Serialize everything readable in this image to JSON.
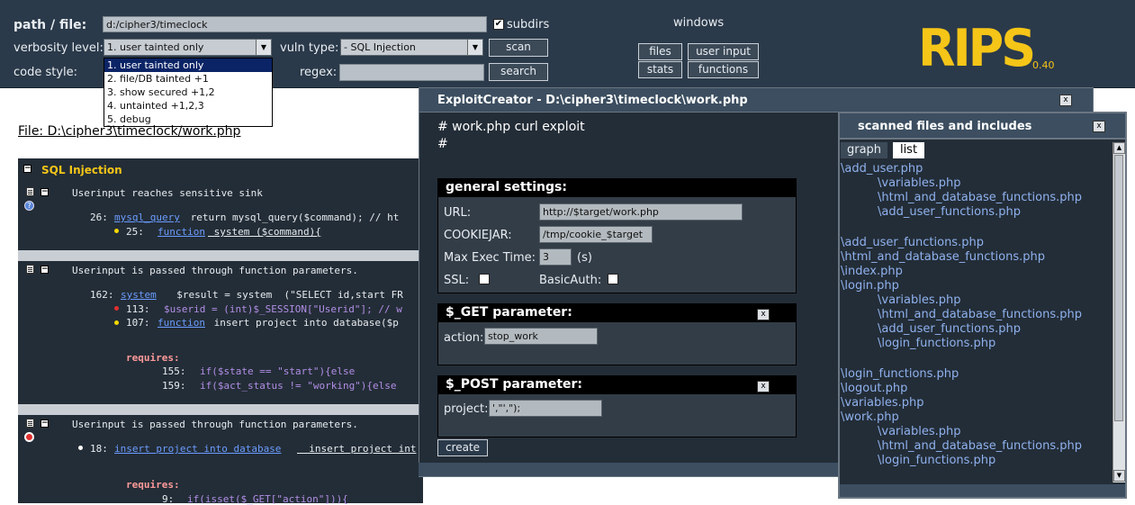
{
  "topbar": {
    "path_label": "path / file:",
    "path_value": "d:/cipher3/timeclock",
    "subdirs_label": "subdirs",
    "subdirs_checked": "✔",
    "verbosity_label": "verbosity level:",
    "verbosity_selected": "1. user tainted only",
    "verbosity_options": [
      "1. user tainted only",
      "2. file/DB tainted +1",
      "3. show secured +1,2",
      "4. untainted +1,2,3",
      "5. debug"
    ],
    "vuln_label": "vuln type:",
    "vuln_selected": "- SQL Injection",
    "scan_label": "scan",
    "code_style_label": "code style:",
    "regex_label": "regex:",
    "regex_value": "",
    "search_label": "search",
    "windows_label": "windows",
    "files_label": "files",
    "user_input_label": "user input",
    "stats_label": "stats",
    "functions_label": "functions"
  },
  "logo": {
    "name": "RIPS",
    "version": "0.40",
    "color": "#f5c518"
  },
  "file_title": "File: D:\\cipher3\\timeclock/work.php",
  "vuln_section": {
    "title": "SQL Injection",
    "blocks": [
      {
        "heading": "Userinput reaches sensitive sink",
        "lines": [
          {
            "num": "26:",
            "fn": "mysql_query",
            "code": " return mysql_query($command); // ht"
          },
          {
            "num": "25:",
            "fn": "function",
            "code": " system ($command){"
          }
        ]
      },
      {
        "heading": "Userinput is passed through function parameters.",
        "lines": [
          {
            "num": "162:",
            "fn": "system",
            "code": "  $result = system  (\"SELECT id,start FR"
          },
          {
            "num": "113:",
            "fn": "",
            "code": "$userid = (int)$_SESSION[\"Userid\"]; // w"
          },
          {
            "num": "107:",
            "fn": "function",
            "code": " insert project into database($p"
          }
        ],
        "requires_label": "requires:",
        "requires": [
          {
            "num": "155:",
            "code": "if($state == \"start\"){else"
          },
          {
            "num": "159:",
            "code": "if($act_status != \"working\"){else"
          }
        ]
      },
      {
        "heading": "Userinput is passed through function parameters.",
        "lines": [
          {
            "num": "18:",
            "fn": "insert project into database",
            "code": "  insert project int"
          }
        ],
        "requires_label": "requires:",
        "requires": [
          {
            "num": "9:",
            "code": "if(isset($_GET[\"action\"])){"
          }
        ]
      }
    ]
  },
  "exploit": {
    "title": "ExploitCreator - D:\\cipher3\\timeclock\\work.php",
    "close": "x",
    "comment1": "# work.php curl exploit",
    "comment2": "#",
    "general_title": "general settings:",
    "url_label": "URL:",
    "url_value": "http://$target/work.php",
    "cookiejar_label": "COOKIEJAR:",
    "cookiejar_value": "/tmp/cookie_$target",
    "maxexec_label": "Max Exec Time:",
    "maxexec_value": "3",
    "maxexec_unit": "(s)",
    "ssl_label": "SSL:",
    "basicauth_label": "BasicAuth:",
    "get_title": "$_GET parameter:",
    "get_close": "x",
    "action_label": "action:",
    "action_value": "stop_work",
    "post_title": "$_POST parameter:",
    "post_close": "x",
    "project_label": "project:",
    "project_value": "',\"',\");",
    "create_label": "create"
  },
  "scanned": {
    "title": "scanned files and includes",
    "close": "x",
    "tab_graph": "graph",
    "tab_list": "list",
    "files": [
      {
        "name": "\\add_user.php",
        "indent": 0
      },
      {
        "name": "\\variables.php",
        "indent": 1
      },
      {
        "name": "\\html_and_database_functions.php",
        "indent": 1
      },
      {
        "name": "\\add_user_functions.php",
        "indent": 1
      },
      {
        "name": "",
        "indent": 0
      },
      {
        "name": "\\add_user_functions.php",
        "indent": 0
      },
      {
        "name": "\\html_and_database_functions.php",
        "indent": 0
      },
      {
        "name": "\\index.php",
        "indent": 0
      },
      {
        "name": "\\login.php",
        "indent": 0
      },
      {
        "name": "\\variables.php",
        "indent": 1
      },
      {
        "name": "\\html_and_database_functions.php",
        "indent": 1
      },
      {
        "name": "\\add_user_functions.php",
        "indent": 1
      },
      {
        "name": "\\login_functions.php",
        "indent": 1
      },
      {
        "name": "",
        "indent": 0
      },
      {
        "name": "\\login_functions.php",
        "indent": 0
      },
      {
        "name": "\\logout.php",
        "indent": 0
      },
      {
        "name": "\\variables.php",
        "indent": 0
      },
      {
        "name": "\\work.php",
        "indent": 0
      },
      {
        "name": "\\variables.php",
        "indent": 1
      },
      {
        "name": "\\html_and_database_functions.php",
        "indent": 1
      },
      {
        "name": "\\login_functions.php",
        "indent": 1
      }
    ]
  }
}
